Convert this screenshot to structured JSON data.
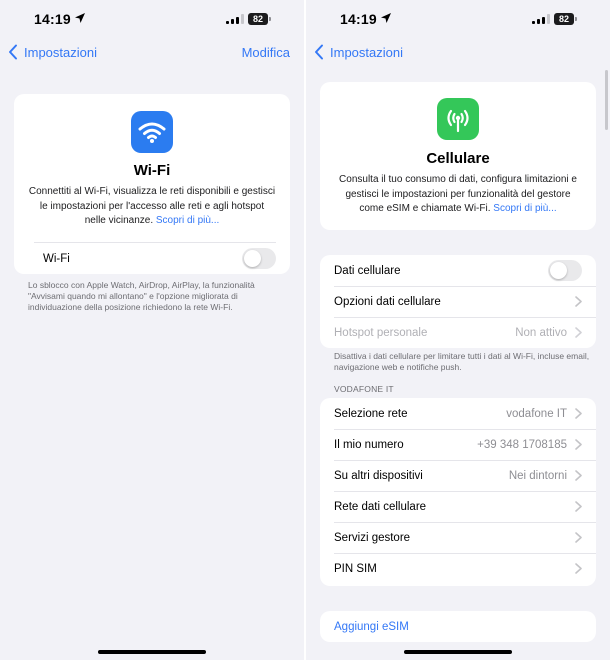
{
  "colors": {
    "accent": "#3478f6",
    "wifi_icon_bg": "#2b7cf0",
    "cellular_icon_bg": "#34c759"
  },
  "left": {
    "status": {
      "time": "14:19",
      "battery": "82"
    },
    "nav": {
      "back_label": "Impostazioni",
      "edit_label": "Modifica"
    },
    "card": {
      "icon": "wifi-icon",
      "title": "Wi-Fi",
      "description": "Connettiti al Wi-Fi, visualizza le reti disponibili e gestisci le impostazioni per l'accesso alle reti e agli hotspot nelle vicinanze.",
      "link": "Scopri di più..."
    },
    "wifi_row": {
      "label": "Wi-Fi",
      "toggle_on": false
    },
    "footnote": "Lo sblocco con Apple Watch, AirDrop, AirPlay, la funzionalità \"Avvisami quando mi allontano\" e l'opzione migliorata di individuazione della posizione richiedono la rete Wi-Fi."
  },
  "right": {
    "status": {
      "time": "14:19",
      "battery": "82"
    },
    "nav": {
      "back_label": "Impostazioni"
    },
    "card": {
      "icon": "cellular-antenna-icon",
      "title": "Cellulare",
      "description": "Consulta il tuo consumo di dati, configura limitazioni e gestisci le impostazioni per funzionalità del gestore come eSIM e chiamate Wi-Fi.",
      "link": "Scopri di più..."
    },
    "group1": [
      {
        "label": "Dati cellulare",
        "type": "toggle",
        "toggle_on": false
      },
      {
        "label": "Opzioni dati cellulare",
        "type": "chevron"
      },
      {
        "label": "Hotspot personale",
        "value": "Non attivo",
        "type": "chevron",
        "disabled": true
      }
    ],
    "group1_footnote": "Disattiva i dati cellulare per limitare tutti i dati al Wi-Fi, incluse email, navigazione web e notifiche push.",
    "section_header": "VODAFONE IT",
    "group2": [
      {
        "label": "Selezione rete",
        "value": "vodafone IT"
      },
      {
        "label": "Il mio numero",
        "value": "+39 348 1708185"
      },
      {
        "label": "Su altri dispositivi",
        "value": "Nei dintorni"
      },
      {
        "label": "Rete dati cellulare",
        "value": ""
      },
      {
        "label": "Servizi gestore",
        "value": ""
      },
      {
        "label": "PIN SIM",
        "value": ""
      }
    ],
    "add_esim": "Aggiungi eSIM"
  }
}
